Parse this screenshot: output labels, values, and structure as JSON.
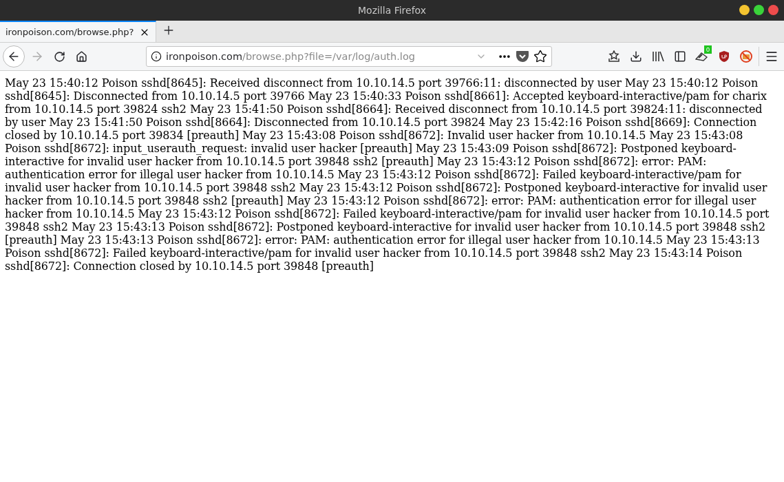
{
  "window": {
    "title": "Mozilla Firefox"
  },
  "tabs": [
    {
      "label": "ironpoison.com/browse.php?",
      "selected": true
    }
  ],
  "url": {
    "domain": "ironpoison.com",
    "path": "/browse.php?file=/var/log/auth.log"
  },
  "extension_badge": "0",
  "content": "May 23 15:40:12 Poison sshd[8645]: Received disconnect from 10.10.14.5 port 39766:11: disconnected by user May 23 15:40:12 Poison sshd[8645]: Disconnected from 10.10.14.5 port 39766 May 23 15:40:33 Poison sshd[8661]: Accepted keyboard-interactive/pam for charix from 10.10.14.5 port 39824 ssh2 May 23 15:41:50 Poison sshd[8664]: Received disconnect from 10.10.14.5 port 39824:11: disconnected by user May 23 15:41:50 Poison sshd[8664]: Disconnected from 10.10.14.5 port 39824 May 23 15:42:16 Poison sshd[8669]: Connection closed by 10.10.14.5 port 39834 [preauth] May 23 15:43:08 Poison sshd[8672]: Invalid user hacker from 10.10.14.5 May 23 15:43:08 Poison sshd[8672]: input_userauth_request: invalid user hacker [preauth] May 23 15:43:09 Poison sshd[8672]: Postponed keyboard-interactive for invalid user hacker from 10.10.14.5 port 39848 ssh2 [preauth] May 23 15:43:12 Poison sshd[8672]: error: PAM: authentication error for illegal user hacker from 10.10.14.5 May 23 15:43:12 Poison sshd[8672]: Failed keyboard-interactive/pam for invalid user hacker from 10.10.14.5 port 39848 ssh2 May 23 15:43:12 Poison sshd[8672]: Postponed keyboard-interactive for invalid user hacker from 10.10.14.5 port 39848 ssh2 [preauth] May 23 15:43:12 Poison sshd[8672]: error: PAM: authentication error for illegal user hacker from 10.10.14.5 May 23 15:43:12 Poison sshd[8672]: Failed keyboard-interactive/pam for invalid user hacker from 10.10.14.5 port 39848 ssh2 May 23 15:43:13 Poison sshd[8672]: Postponed keyboard-interactive for invalid user hacker from 10.10.14.5 port 39848 ssh2 [preauth] May 23 15:43:13 Poison sshd[8672]: error: PAM: authentication error for illegal user hacker from 10.10.14.5 May 23 15:43:13 Poison sshd[8672]: Failed keyboard-interactive/pam for invalid user hacker from 10.10.14.5 port 39848 ssh2 May 23 15:43:14 Poison sshd[8672]: Connection closed by 10.10.14.5 port 39848 [preauth]"
}
